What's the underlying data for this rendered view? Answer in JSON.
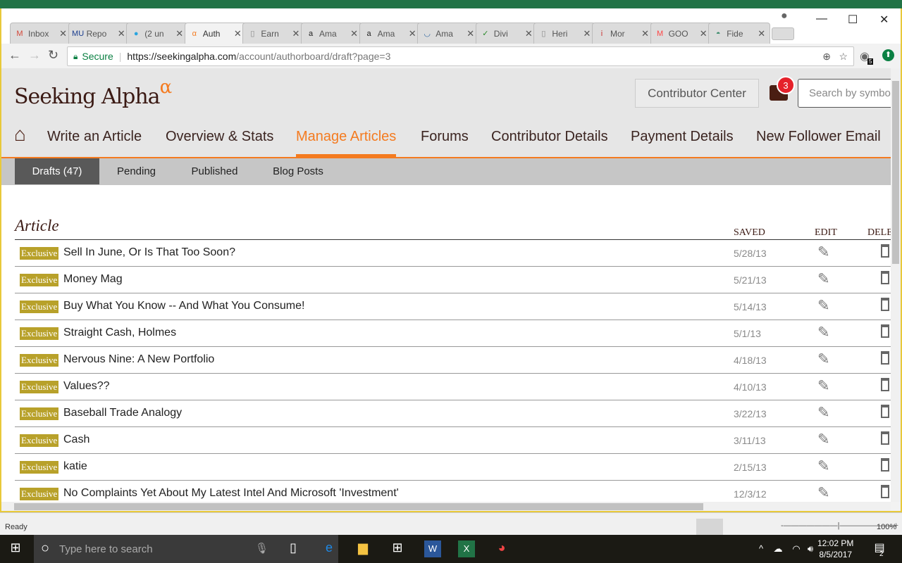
{
  "excel": {
    "status": "Ready",
    "zoom": "100%"
  },
  "browser": {
    "tabs": [
      {
        "title": "Inbox",
        "icon": "gmail-icon",
        "color": "#d44638",
        "glyph": "M"
      },
      {
        "title": "Repo",
        "icon": "mu-scoop-icon",
        "color": "#1a3d8f",
        "glyph": "MU"
      },
      {
        "title": "(2 un",
        "icon": "att-icon",
        "color": "#2aa5e0",
        "glyph": "●"
      },
      {
        "title": "Auth",
        "icon": "seeking-alpha-icon",
        "color": "#f47b20",
        "glyph": "α",
        "active": true
      },
      {
        "title": "Earn",
        "icon": "page-icon",
        "color": "#888",
        "glyph": "▯"
      },
      {
        "title": "Ama",
        "icon": "amazon-icon",
        "color": "#222",
        "glyph": "a"
      },
      {
        "title": "Ama",
        "icon": "amazon-icon",
        "color": "#222",
        "glyph": "a"
      },
      {
        "title": "Ama",
        "icon": "amazon-icon",
        "color": "#3a6ea5",
        "glyph": "◡"
      },
      {
        "title": "Divi",
        "icon": "dividend-icon",
        "color": "#2b8a2b",
        "glyph": "✓"
      },
      {
        "title": "Heri",
        "icon": "page-icon",
        "color": "#888",
        "glyph": "▯"
      },
      {
        "title": "Mor",
        "icon": "morningstar-icon",
        "color": "#c33",
        "glyph": "i"
      },
      {
        "title": "GOO",
        "icon": "marketwatch-icon",
        "color": "#f44",
        "glyph": "M"
      },
      {
        "title": "Fide",
        "icon": "fidelity-icon",
        "color": "#3a8a6a",
        "glyph": "◓"
      }
    ],
    "secure_label": "Secure",
    "url_host": "https://seekingalpha.com",
    "url_path": "/account/authorboard/draft?page=3",
    "extension_badge": "5"
  },
  "site": {
    "logo": "Seeking Alpha",
    "logo_mark": "α",
    "contributor_center": "Contributor Center",
    "notifications": "3",
    "search_placeholder": "Search by symbol",
    "nav": [
      "Write an Article",
      "Overview & Stats",
      "Manage Articles",
      "Forums",
      "Contributor Details",
      "Payment Details",
      "New Follower Email"
    ],
    "subnav": [
      "Drafts (47)",
      "Pending",
      "Published",
      "Blog Posts"
    ],
    "columns": {
      "article": "Article",
      "saved": "SAVED",
      "edit": "EDIT",
      "delete": "DELETE"
    },
    "badge": "Exclusive",
    "rows": [
      {
        "title": "Sell In June, Or Is That Too Soon?",
        "saved": "5/28/13"
      },
      {
        "title": "Money Mag",
        "saved": "5/21/13"
      },
      {
        "title": "Buy What You Know -- And What You Consume!",
        "saved": "5/14/13"
      },
      {
        "title": "Straight Cash, Holmes",
        "saved": "5/1/13"
      },
      {
        "title": "Nervous Nine: A New Portfolio",
        "saved": "4/18/13"
      },
      {
        "title": "Values??",
        "saved": "4/10/13"
      },
      {
        "title": "Baseball Trade Analogy",
        "saved": "3/22/13"
      },
      {
        "title": "Cash",
        "saved": "3/11/13"
      },
      {
        "title": "katie",
        "saved": "2/15/13"
      },
      {
        "title": "No Complaints Yet About My Latest Intel And Microsoft 'Investment'",
        "saved": "12/3/12"
      }
    ]
  },
  "taskbar": {
    "search_placeholder": "Type here to search",
    "time": "12:02 PM",
    "date": "8/5/2017",
    "notifications": "2"
  }
}
